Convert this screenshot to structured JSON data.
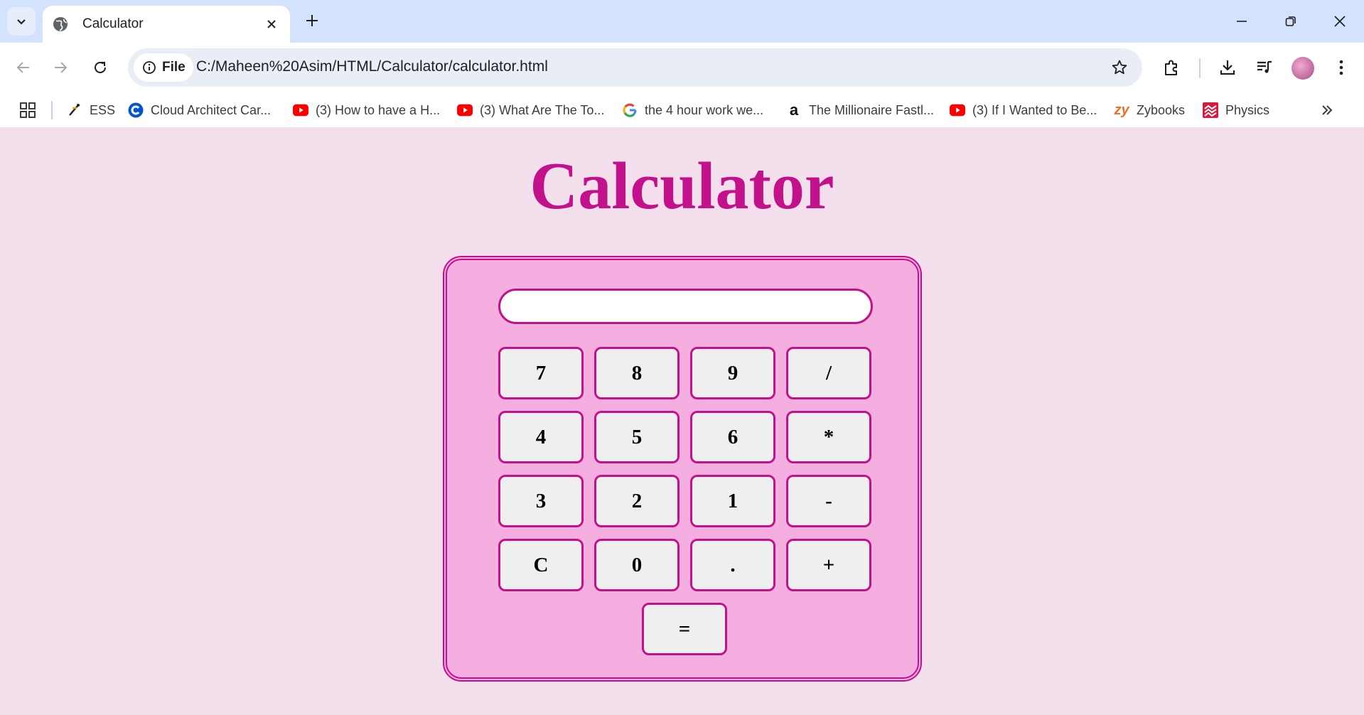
{
  "browser": {
    "tab": {
      "title": "Calculator"
    },
    "omnibox": {
      "chip_label": "File",
      "url": "C:/Maheen%20Asim/HTML/Calculator/calculator.html"
    },
    "bookmarks": [
      {
        "label": "ESS",
        "icon": "ess-icon"
      },
      {
        "label": "Cloud Architect Car...",
        "icon": "coursera-icon"
      },
      {
        "label": "(3) How to have a H...",
        "icon": "youtube-icon"
      },
      {
        "label": "(3) What Are The To...",
        "icon": "youtube-icon"
      },
      {
        "label": "the 4 hour work we...",
        "icon": "google-icon"
      },
      {
        "label": "The Millionaire Fastl...",
        "icon": "amazon-icon"
      },
      {
        "label": "(3) If I Wanted to Be...",
        "icon": "youtube-icon"
      },
      {
        "label": "Zybooks",
        "icon": "zybooks-icon"
      },
      {
        "label": "Physics",
        "icon": "physics-icon"
      }
    ]
  },
  "page": {
    "title": "Calculator",
    "display_value": "",
    "keys": {
      "k7": "7",
      "k8": "8",
      "k9": "9",
      "kdiv": "/",
      "k4": "4",
      "k5": "5",
      "k6": "6",
      "kmul": "*",
      "k3": "3",
      "k2": "2",
      "k1": "1",
      "ksub": "-",
      "kclear": "C",
      "k0": "0",
      "kdot": ".",
      "kadd": "+",
      "keq": "="
    }
  },
  "colors": {
    "page_background": "#f4dfec",
    "title": "#c2118a",
    "calculator_body": "#f4aee0",
    "accent_border": "#c2118a",
    "key_background": "#efefef"
  }
}
